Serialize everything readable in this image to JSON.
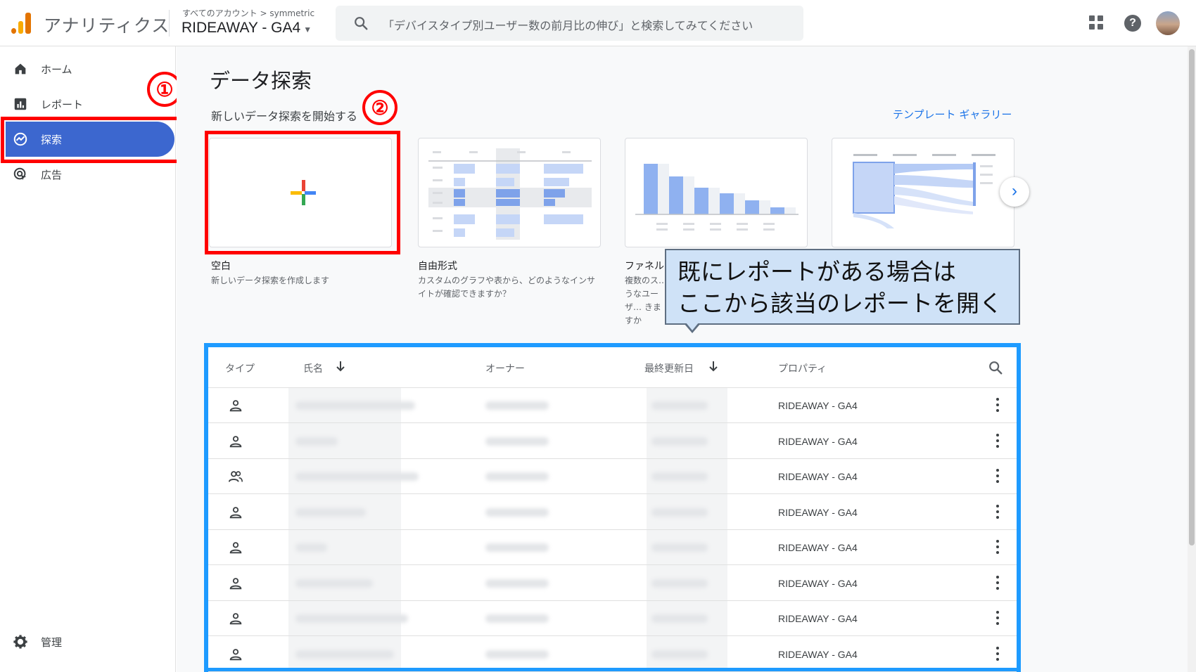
{
  "header": {
    "app_title": "アナリティクス",
    "breadcrumb": "すべてのアカウント > symmetric",
    "property": "RIDEAWAY - GA4",
    "search_placeholder": "「デバイスタイプ別ユーザー数の前月比の伸び」と検索してみてください"
  },
  "sidebar": {
    "items": [
      {
        "label": "ホーム",
        "icon": "home-icon"
      },
      {
        "label": "レポート",
        "icon": "bar-chart-icon"
      },
      {
        "label": "探索",
        "icon": "explore-icon",
        "active": true
      },
      {
        "label": "広告",
        "icon": "ads-icon"
      }
    ],
    "admin_label": "管理"
  },
  "annotations": {
    "badge1": "①",
    "badge2": "②",
    "highlight_color": "#ff0000",
    "table_highlight_color": "#1e9bff",
    "callout": "既にレポートがある場合は\nここから該当のレポートを開く"
  },
  "main": {
    "title": "データ探索",
    "start_label": "新しいデータ探索を開始する",
    "gallery_link": "テンプレート ギャラリー",
    "cards": [
      {
        "title": "空白",
        "desc": "新しいデータ探索を作成します"
      },
      {
        "title": "自由形式",
        "desc": "カスタムのグラフや表から、どのようなインサイトが確認できますか？"
      },
      {
        "title": "ファネル",
        "desc": "複数のス… うなユーザ… きますか"
      },
      {
        "title": "",
        "desc": ""
      }
    ]
  },
  "table": {
    "columns": [
      "タイプ",
      "氏名",
      "オーナー",
      "最終更新日",
      "プロパティ"
    ],
    "rows": [
      {
        "type": "single-user-icon",
        "property": "RIDEAWAY - GA4"
      },
      {
        "type": "single-user-icon",
        "property": "RIDEAWAY - GA4"
      },
      {
        "type": "group-user-icon",
        "property": "RIDEAWAY - GA4"
      },
      {
        "type": "single-user-icon",
        "property": "RIDEAWAY - GA4"
      },
      {
        "type": "single-user-icon",
        "property": "RIDEAWAY - GA4"
      },
      {
        "type": "single-user-icon",
        "property": "RIDEAWAY - GA4"
      },
      {
        "type": "single-user-icon",
        "property": "RIDEAWAY - GA4"
      },
      {
        "type": "single-user-icon",
        "property": "RIDEAWAY - GA4"
      }
    ]
  }
}
